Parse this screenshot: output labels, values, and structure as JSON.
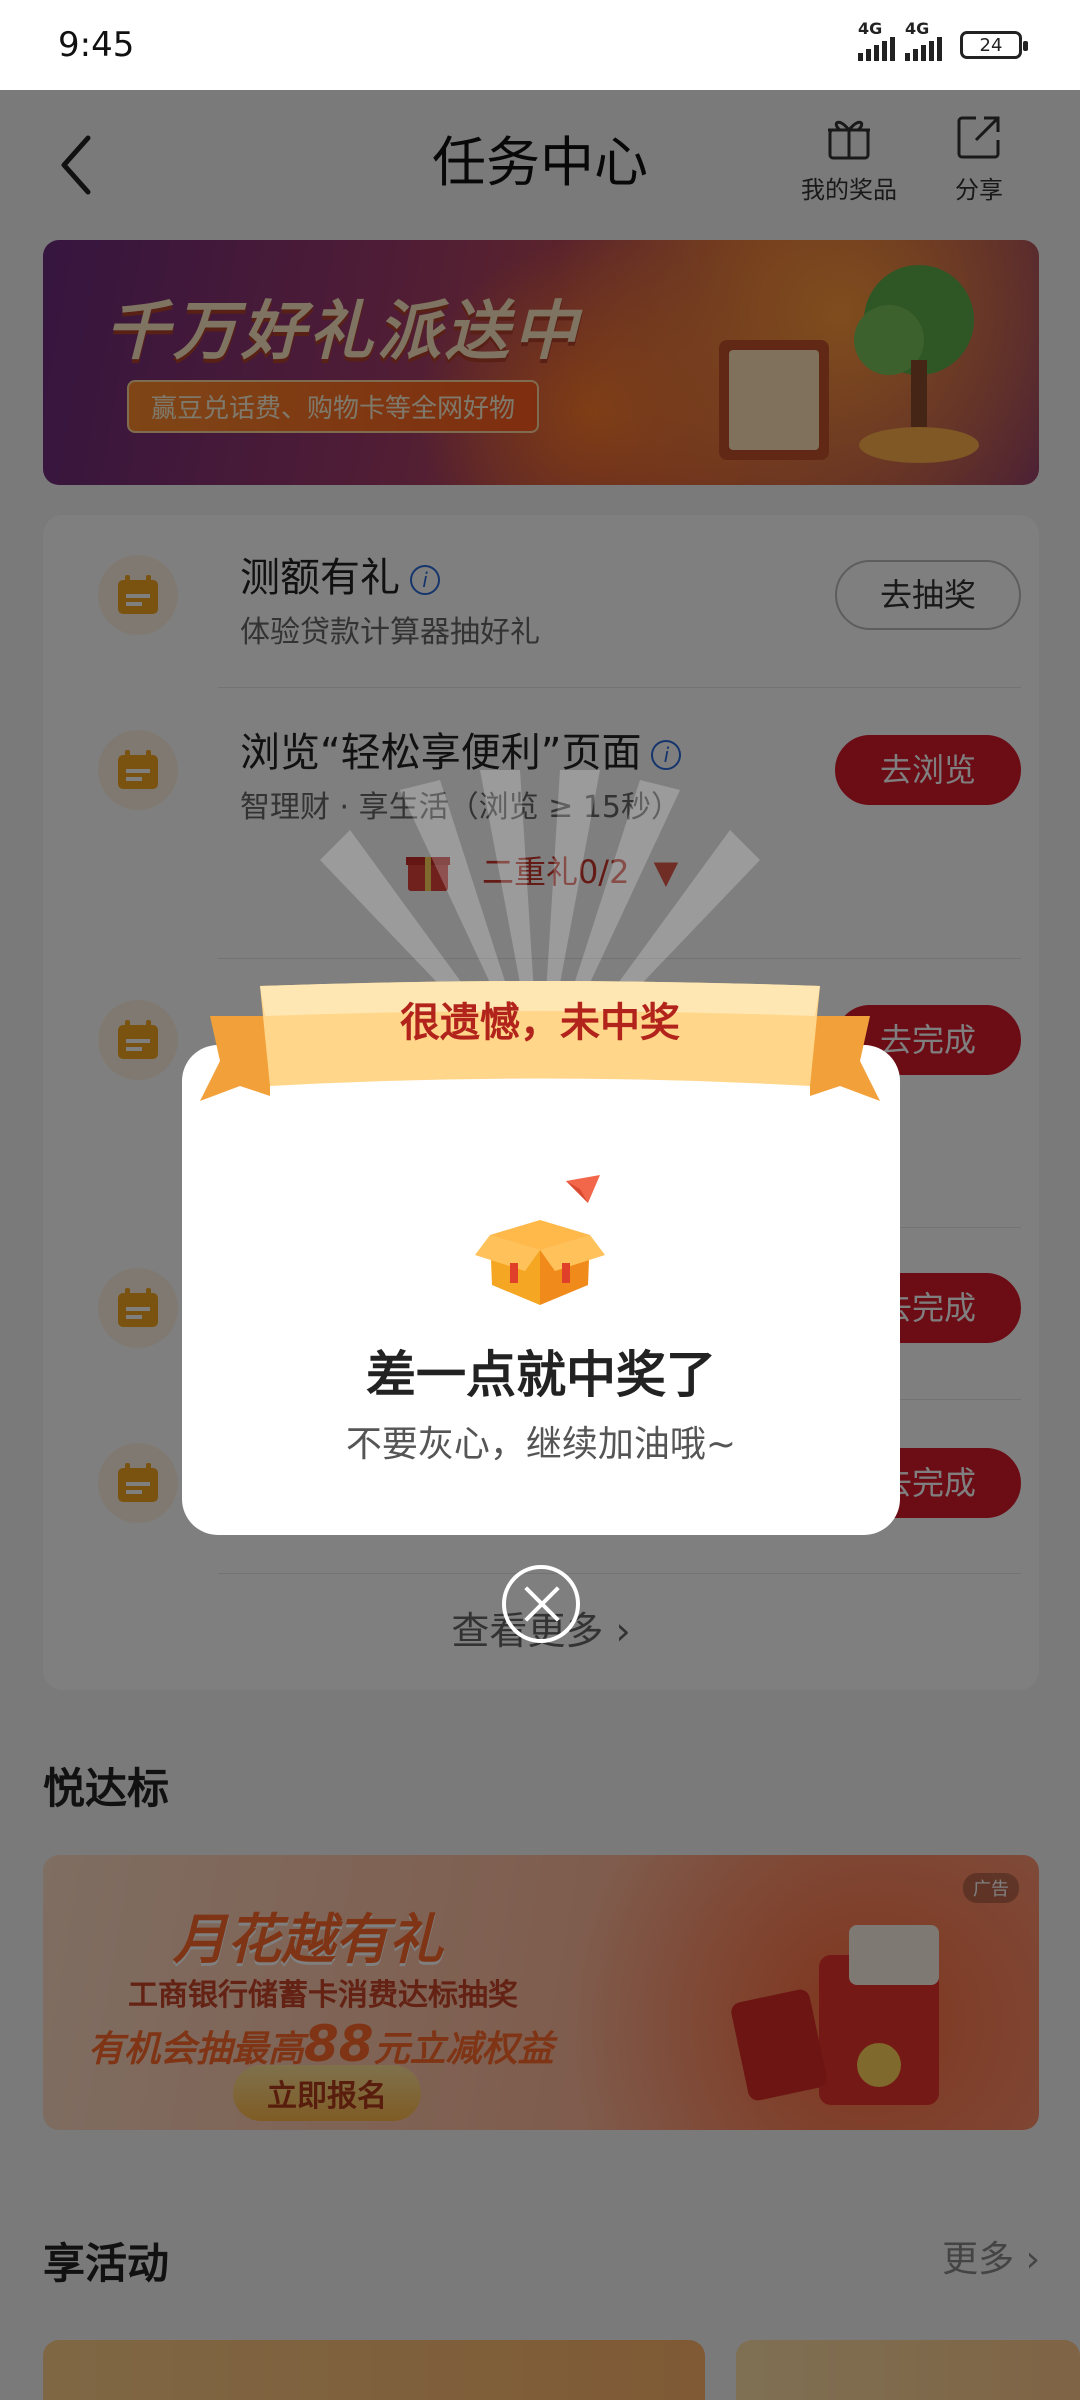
{
  "status_bar": {
    "time": "9:45",
    "network_1": "4G",
    "network_2": "4G",
    "battery": "24"
  },
  "header": {
    "title": "任务中心",
    "prize_label": "我的奖品",
    "share_label": "分享"
  },
  "banner": {
    "headline": "千万好礼派送中",
    "tag": "赢豆兑话费、购物卡等全网好物"
  },
  "tasks": [
    {
      "name": "测额有礼",
      "desc": "体验贷款计算器抽好礼",
      "button": "去抽奖"
    },
    {
      "name": "浏览“轻松享便利”页面",
      "desc": "智理财 · 享生活（浏览 ≥ 15秒）",
      "button": "去浏览"
    },
    {
      "name": "",
      "desc": "",
      "button": "去完成"
    },
    {
      "name": "",
      "desc": "",
      "button": "去完成"
    },
    {
      "name": "",
      "desc": "",
      "button": "去完成"
    }
  ],
  "gift_row": {
    "label": "二重礼0/2"
  },
  "view_more": "查看更多 ›",
  "section_yuedabiao": "悦达标",
  "ad_banner": {
    "title": "月花越有礼",
    "line1": "工商银行储蓄卡消费达标抽奖",
    "line2_prefix": "有机会抽最高",
    "line2_amount": "88",
    "line2_suffix": "元立减权益",
    "cta": "立即报名",
    "ad_tag": "广告"
  },
  "section_activity": "享活动",
  "section_activity_more": "更多 ›",
  "modal": {
    "ribbon_text": "很遗憾，未中奖",
    "title": "差一点就中奖了",
    "subtitle": "不要灰心，继续加油哦~"
  },
  "colors": {
    "primary_red": "#d9182a",
    "accent_orange": "#f5a623",
    "ribbon_text": "#b2241b"
  }
}
